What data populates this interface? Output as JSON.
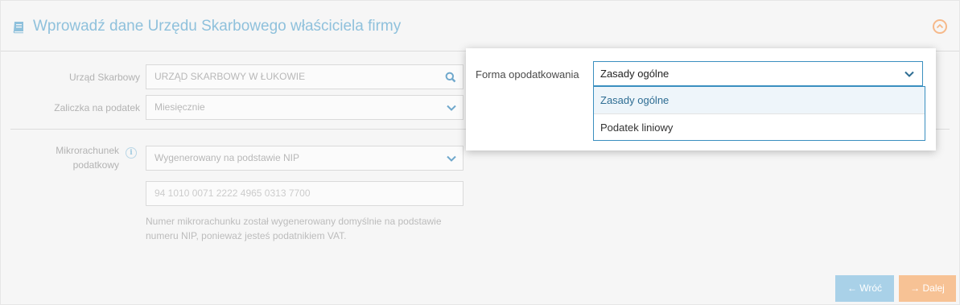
{
  "header": {
    "title": "Wprowadź dane Urzędu Skarbowego właściciela firmy",
    "icon": "book-icon",
    "collapse_icon": "chevron-up-circle-icon"
  },
  "form": {
    "office": {
      "label": "Urząd Skarbowy",
      "value": "URZĄD SKARBOWY W ŁUKOWIE",
      "icon": "search-icon"
    },
    "advance": {
      "label": "Zaliczka na podatek",
      "value": "Miesięcznie",
      "icon": "chevron-down-icon"
    },
    "micro": {
      "label_line1": "Mikrorachunek",
      "label_line2": "podatkowy",
      "info_icon": "info-icon",
      "info_glyph": "i",
      "select_value": "Wygenerowany na podstawie NIP",
      "account_number": "94 1010 0071 2222 4965 0313 7700",
      "helper_text": "Numer mikrorachunku został wygenerowany domyślnie na podstawie numeru NIP, ponieważ jesteś podatnikiem VAT."
    }
  },
  "popup": {
    "label": "Forma opodatkowania",
    "selected": "Zasady ogólne",
    "options": [
      "Zasady ogólne",
      "Podatek liniowy"
    ]
  },
  "buttons": {
    "back": "← Wróć",
    "next": "→ Dalej"
  },
  "colors": {
    "accent": "#3a8fbf",
    "title": "#8fc1dc",
    "orange": "#f7c295"
  }
}
